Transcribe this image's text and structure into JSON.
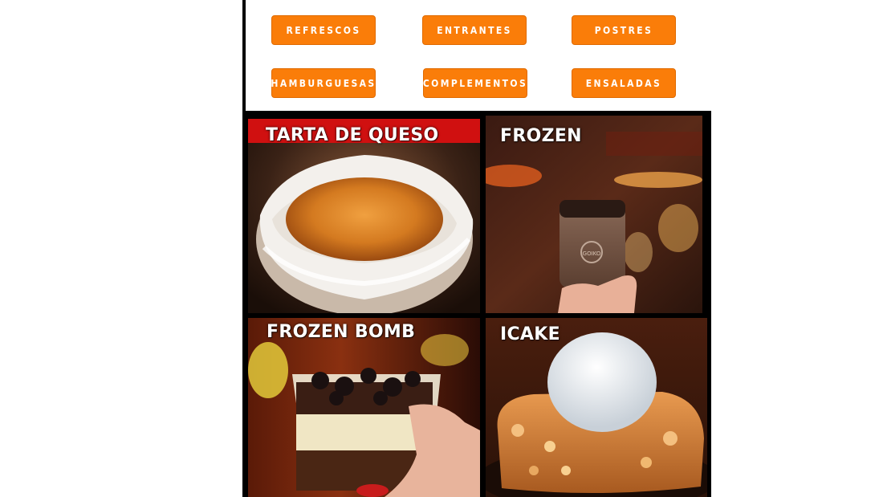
{
  "nav": {
    "categories": [
      {
        "label": "REFRESCOS"
      },
      {
        "label": "ENTRANTES"
      },
      {
        "label": "POSTRES"
      },
      {
        "label": "HAMBURGUESAS"
      },
      {
        "label": "COMPLEMENTOS"
      },
      {
        "label": "ENSALADAS"
      }
    ]
  },
  "products": [
    {
      "name": "TARTA DE QUESO"
    },
    {
      "name": "FROZEN",
      "jar_text": "GOIKO"
    },
    {
      "name": "FROZEN BOMB"
    },
    {
      "name": "ICAKE"
    }
  ],
  "colors": {
    "button": "#fa7d09",
    "button_text": "#ffffff",
    "frame": "#000000",
    "label": "#ffffff"
  }
}
